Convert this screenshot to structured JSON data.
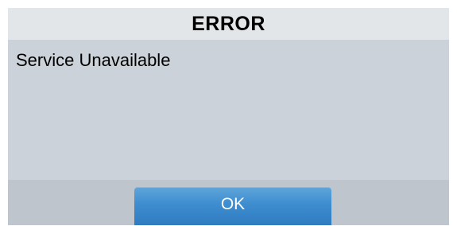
{
  "dialog": {
    "title": "ERROR",
    "message": "Service Unavailable",
    "ok_label": "OK"
  },
  "colors": {
    "header_bg": "#e3e6e9",
    "body_bg": "#ccd2d9",
    "footer_bg": "#bec5cd",
    "button_bg": "#3e8dcf",
    "button_text": "#ffffff"
  }
}
